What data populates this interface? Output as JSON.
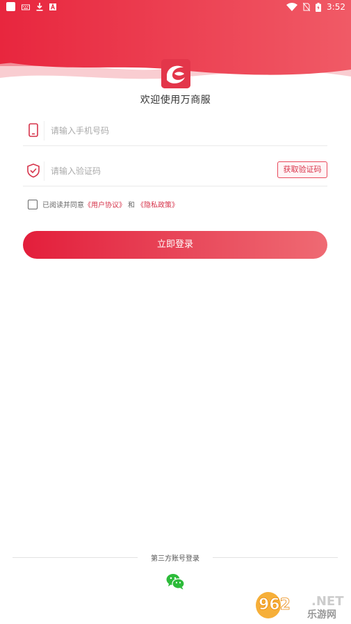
{
  "status_bar": {
    "time": "3:52",
    "icons": [
      "notification-square-icon",
      "keyboard-icon",
      "download-icon",
      "font-icon",
      "wifi-icon",
      "no-sim-icon",
      "battery-icon"
    ]
  },
  "header": {
    "app_title": "欢迎使用万商服",
    "brand_color": "#e3364a"
  },
  "phone_field": {
    "placeholder": "请输入手机号码",
    "value": "",
    "icon": "phone-icon"
  },
  "code_field": {
    "placeholder": "请输入验证码",
    "value": "",
    "icon": "shield-check-icon",
    "get_code_label": "获取验证码"
  },
  "agreement": {
    "checked": false,
    "prefix": "已阅读并同意",
    "user_agreement": "《用户协议》",
    "and": "和",
    "privacy_policy": "《隐私政策》"
  },
  "login_button": {
    "label": "立即登录"
  },
  "third_party": {
    "label": "第三方账号登录",
    "providers": [
      "wechat-icon"
    ]
  },
  "watermark": {
    "top_text": "962",
    "top_suffix": ".NET",
    "bottom_text": "乐游网"
  }
}
